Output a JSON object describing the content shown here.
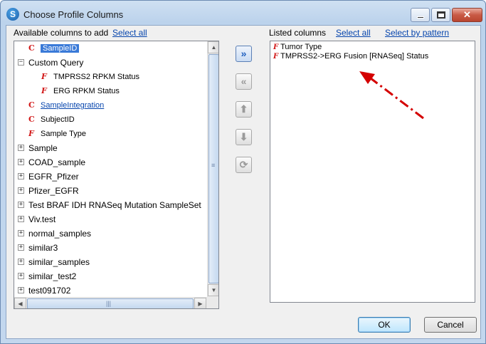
{
  "window": {
    "title": "Choose Profile Columns",
    "icon": "app-s-icon"
  },
  "left": {
    "label": "Available columns to add",
    "select_all": "Select all",
    "tree": [
      {
        "type": "C",
        "label": "SampleID",
        "indent": 0,
        "selected": true
      },
      {
        "expander": "−",
        "label": "Custom Query",
        "indent": 0
      },
      {
        "type": "F",
        "label": "TMPRSS2 RPKM Status",
        "indent": 1
      },
      {
        "type": "F",
        "label": "ERG RPKM Status",
        "indent": 1
      },
      {
        "type": "C",
        "label": "SampleIntegration",
        "indent": 0,
        "link": true
      },
      {
        "type": "C",
        "label": "SubjectID",
        "indent": 0
      },
      {
        "type": "F",
        "label": "Sample Type",
        "indent": 0
      },
      {
        "expander": "+",
        "label": "Sample",
        "indent": 0
      },
      {
        "expander": "+",
        "label": "COAD_sample",
        "indent": 0
      },
      {
        "expander": "+",
        "label": "EGFR_Pfizer",
        "indent": 0
      },
      {
        "expander": "+",
        "label": "Pfizer_EGFR",
        "indent": 0
      },
      {
        "expander": "+",
        "label": "Test BRAF IDH RNASeq Mutation SampleSet",
        "indent": 0
      },
      {
        "expander": "+",
        "label": "Viv.test",
        "indent": 0
      },
      {
        "expander": "+",
        "label": "normal_samples",
        "indent": 0
      },
      {
        "expander": "+",
        "label": "similar3",
        "indent": 0
      },
      {
        "expander": "+",
        "label": "similar_samples",
        "indent": 0
      },
      {
        "expander": "+",
        "label": "similar_test2",
        "indent": 0
      },
      {
        "expander": "+",
        "label": "test091702",
        "indent": 0
      }
    ]
  },
  "right": {
    "label": "Listed columns",
    "select_all": "Select all",
    "select_by_pattern": "Select by pattern",
    "items": [
      {
        "type": "F",
        "label": "Tumor Type"
      },
      {
        "type": "F",
        "label": "TMPRSS2->ERG Fusion [RNASeq] Status"
      }
    ]
  },
  "middle_buttons": [
    {
      "name": "add-all-button",
      "glyph": "»",
      "icon": "double-chevron-right-icon",
      "enabled": true
    },
    {
      "name": "remove-all-button",
      "glyph": "«",
      "icon": "double-chevron-left-icon",
      "enabled": false
    },
    {
      "name": "move-up-button",
      "glyph": "⬆",
      "icon": "arrow-up-icon",
      "enabled": false
    },
    {
      "name": "move-down-button",
      "glyph": "⬇",
      "icon": "arrow-down-icon",
      "enabled": false
    },
    {
      "name": "refresh-button",
      "glyph": "⟳",
      "icon": "refresh-icon",
      "enabled": false
    }
  ],
  "buttons": {
    "ok": "OK",
    "cancel": "Cancel"
  },
  "colors": {
    "accent": "#3a7ad8",
    "link": "#0645ad",
    "type_tag": "#d21a1a",
    "annotation_arrow": "#d40000"
  }
}
